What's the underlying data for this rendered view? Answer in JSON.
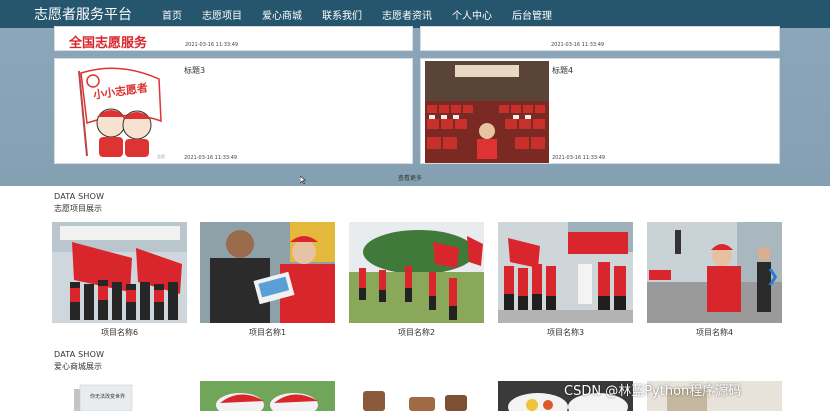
{
  "header": {
    "brand": "志愿者服务平台",
    "nav": [
      "首页",
      "志愿项目",
      "爱心商城",
      "联系我们",
      "志愿者资讯",
      "个人中心",
      "后台管理"
    ]
  },
  "news": {
    "top_left_banner_text": "全国志愿服务",
    "top_left_time": "2021-03-16 11:33:49",
    "top_right_time": "2021-03-16 11:33:49",
    "card3": {
      "title": "标题3",
      "time": "2021-03-16 11:33:49",
      "flag_text": "小小志愿者"
    },
    "card4": {
      "title": "标题4",
      "time": "2021-03-16 11:33:49"
    },
    "more": "查看更多"
  },
  "projects": {
    "heading_en": "DATA SHOW",
    "heading_cn": "志愿项目展示",
    "items": [
      "项目名称6",
      "项目名称1",
      "项目名称2",
      "项目名称3",
      "项目名称4"
    ]
  },
  "shop": {
    "heading_en": "DATA SHOW",
    "heading_cn": "爱心商城展示",
    "book_text": "你无法改变世界"
  },
  "watermark": "CSDN @林蓝Python程序源码",
  "colors": {
    "nav_bg": "#26566e",
    "band_bg": "#87a3b5",
    "accent_red": "#d8262c",
    "arrow": "#2c7bd3"
  }
}
